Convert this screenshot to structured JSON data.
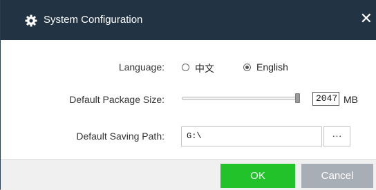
{
  "window": {
    "title": "System Configuration",
    "icon": "gear-icon",
    "close_glyph": "✕"
  },
  "language": {
    "label": "Language:",
    "options": [
      "中文",
      "English"
    ],
    "selected": "English"
  },
  "package_size": {
    "label": "Default Package Size:",
    "value": "2047",
    "unit": "MB",
    "slider_level": 1.0
  },
  "saving_path": {
    "label": "Default Saving Path:",
    "value": "G:\\",
    "browse_label": "···"
  },
  "buttons": {
    "ok": "OK",
    "cancel": "Cancel"
  },
  "colors": {
    "titlebar": "#223344",
    "ok": "#22c22a",
    "cancel": "#a8aeb6"
  }
}
